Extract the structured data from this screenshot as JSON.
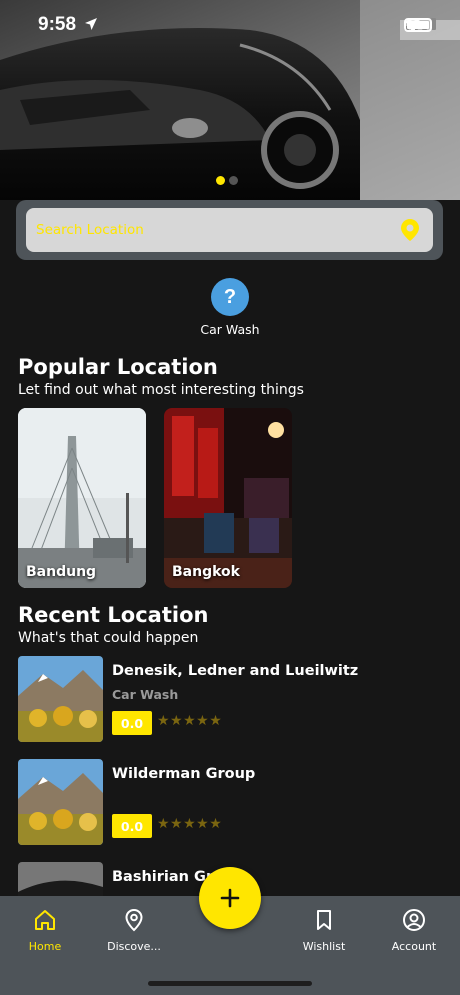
{
  "status_bar": {
    "time": "9:58"
  },
  "carousel": {
    "page_count": 2,
    "active_index": 0
  },
  "search": {
    "placeholder": "Search Location"
  },
  "categories": [
    {
      "label": "Car Wash",
      "icon": "question-icon",
      "color": "#4a9fe0"
    }
  ],
  "popular": {
    "title": "Popular Location",
    "subtitle": "Let find out what most interesting things",
    "items": [
      {
        "name": "Bandung"
      },
      {
        "name": "Bangkok"
      }
    ]
  },
  "recent": {
    "title": "Recent Location",
    "subtitle": "What's that could happen",
    "items": [
      {
        "name": "Denesik, Ledner and Lueilwitz",
        "category": "Car Wash",
        "score": "0.0",
        "stars": "★★★★★"
      },
      {
        "name": "Wilderman Group",
        "category": "",
        "score": "0.0",
        "stars": "★★★★★"
      },
      {
        "name": "Bashirian Gr",
        "category": ""
      }
    ]
  },
  "nav": {
    "items": [
      {
        "label": "Home",
        "icon": "home-icon",
        "active": true
      },
      {
        "label": "Discove...",
        "icon": "map-pin-icon"
      },
      {
        "label": "Wishlist",
        "icon": "bookmark-icon"
      },
      {
        "label": "Account",
        "icon": "account-icon"
      }
    ],
    "fab_icon": "plus-icon"
  },
  "colors": {
    "accent": "#ffe600",
    "background": "#161616",
    "panel": "#4e5459"
  }
}
